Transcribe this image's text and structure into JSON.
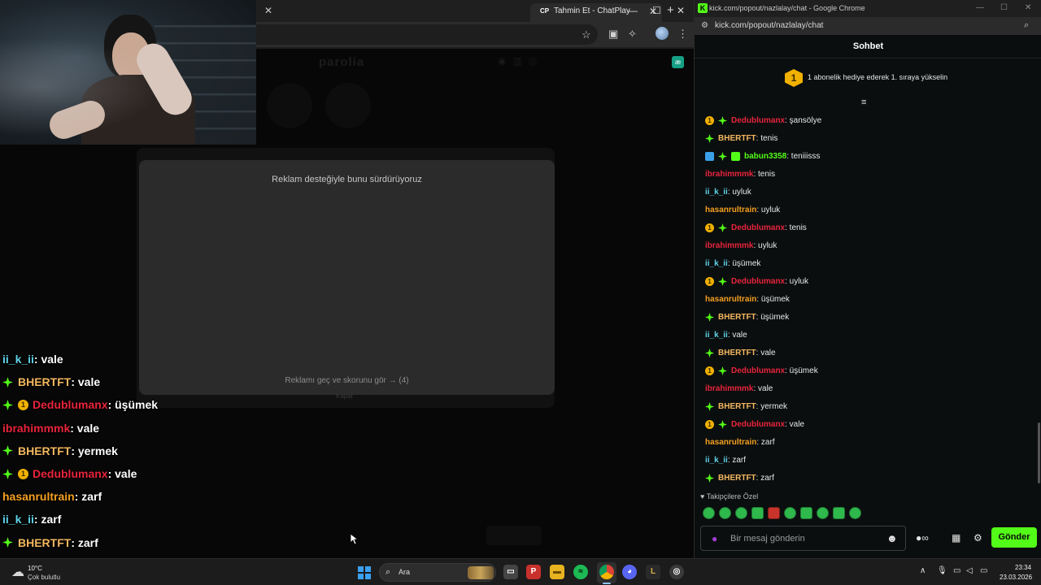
{
  "left_browser": {
    "tab_title": "Tahmin Et - ChatPlay",
    "tab_favicon": "CP",
    "page": {
      "ghost_logo": "parolia",
      "ad_title": "Reklam desteğiyle bunu sürdürüyoruz",
      "ad_skip": "Reklamı geç ve skorunu gör → (4)",
      "ad_under": "Kapat"
    }
  },
  "overlay_chat": [
    {
      "badges": [],
      "user": "ii_k_ii",
      "color": "#5fd3e8",
      "msg": " : vale"
    },
    {
      "badges": [
        "diamond"
      ],
      "user": "BHERTFT",
      "color": "#f4b860",
      "msg": " : vale"
    },
    {
      "badges": [
        "diamond",
        "gift1"
      ],
      "user": "Dedublumanx",
      "color": "#e8243c",
      "msg": " : üşümek"
    },
    {
      "badges": [],
      "user": "ibrahimmmk",
      "color": "#e8243c",
      "msg": " : vale"
    },
    {
      "badges": [
        "diamond"
      ],
      "user": "BHERTFT",
      "color": "#f4b860",
      "msg": " : yermek"
    },
    {
      "badges": [
        "diamond",
        "gift1"
      ],
      "user": "Dedublumanx",
      "color": "#e8243c",
      "msg": " : vale"
    },
    {
      "badges": [],
      "user": "hasanrultrain",
      "color": "#f4a020",
      "msg": " : zarf"
    },
    {
      "badges": [],
      "user": "ii_k_ii",
      "color": "#5fd3e8",
      "msg": " : zarf"
    },
    {
      "badges": [
        "diamond"
      ],
      "user": "BHERTFT",
      "color": "#f4b860",
      "msg": " : zarf"
    }
  ],
  "popout": {
    "window_title": "kick.com/popout/nazlalay/chat - Google Chrome",
    "url": "kick.com/popout/nazlalay/chat",
    "header": "Sohbet",
    "pinned_badge": "1",
    "pinned_text": "1 abonelik hediye ederek 1. sıraya yükselin",
    "messages": [
      {
        "badges": [
          "gift1",
          "diamond"
        ],
        "user": "Dedublumanx",
        "color": "#e8243c",
        "msg": ": şansölye"
      },
      {
        "badges": [
          "diamond"
        ],
        "user": "BHERTFT",
        "color": "#f4b860",
        "msg": ": tenis"
      },
      {
        "badges": [
          "blue",
          "diamond",
          "greenbox"
        ],
        "user": "babun3358",
        "color": "#53fc18",
        "msg": ": teniiisss"
      },
      {
        "badges": [],
        "user": "ibrahimmmk",
        "color": "#e8243c",
        "msg": ": tenis"
      },
      {
        "badges": [],
        "user": "ii_k_ii",
        "color": "#5fd3e8",
        "msg": ": uyluk"
      },
      {
        "badges": [],
        "user": "hasanrultrain",
        "color": "#f4a020",
        "msg": ": uyluk"
      },
      {
        "badges": [
          "gift1",
          "diamond"
        ],
        "user": "Dedublumanx",
        "color": "#e8243c",
        "msg": ": tenis"
      },
      {
        "badges": [],
        "user": "ibrahimmmk",
        "color": "#e8243c",
        "msg": ": uyluk"
      },
      {
        "badges": [],
        "user": "ii_k_ii",
        "color": "#5fd3e8",
        "msg": ": üşümek"
      },
      {
        "badges": [
          "gift1",
          "diamond"
        ],
        "user": "Dedublumanx",
        "color": "#e8243c",
        "msg": ": uyluk"
      },
      {
        "badges": [],
        "user": "hasanrultrain",
        "color": "#f4a020",
        "msg": ": üşümek"
      },
      {
        "badges": [
          "diamond"
        ],
        "user": "BHERTFT",
        "color": "#f4b860",
        "msg": ": üşümek"
      },
      {
        "badges": [],
        "user": "ii_k_ii",
        "color": "#5fd3e8",
        "msg": ": vale"
      },
      {
        "badges": [
          "diamond"
        ],
        "user": "BHERTFT",
        "color": "#f4b860",
        "msg": ": vale"
      },
      {
        "badges": [
          "gift1",
          "diamond"
        ],
        "user": "Dedublumanx",
        "color": "#e8243c",
        "msg": ": üşümek"
      },
      {
        "badges": [],
        "user": "ibrahimmmk",
        "color": "#e8243c",
        "msg": ": vale"
      },
      {
        "badges": [
          "diamond"
        ],
        "user": "BHERTFT",
        "color": "#f4b860",
        "msg": ": yermek"
      },
      {
        "badges": [
          "gift1",
          "diamond"
        ],
        "user": "Dedublumanx",
        "color": "#e8243c",
        "msg": ": vale"
      },
      {
        "badges": [],
        "user": "hasanrultrain",
        "color": "#f4a020",
        "msg": ": zarf"
      },
      {
        "badges": [],
        "user": "ii_k_ii",
        "color": "#5fd3e8",
        "msg": ": zarf"
      },
      {
        "badges": [
          "diamond"
        ],
        "user": "BHERTFT",
        "color": "#f4b860",
        "msg": ": zarf"
      }
    ],
    "follower_label": "Takipçilere Özel",
    "input_placeholder": "Bir mesaj gönderin",
    "send_label": "Gönder",
    "accent": "#53fc18"
  },
  "taskbar": {
    "weather_temp": "10°C",
    "weather_desc": "Çok bulutlu",
    "search_label": "Ara",
    "time": "23:34",
    "date": "23.03.2026"
  }
}
